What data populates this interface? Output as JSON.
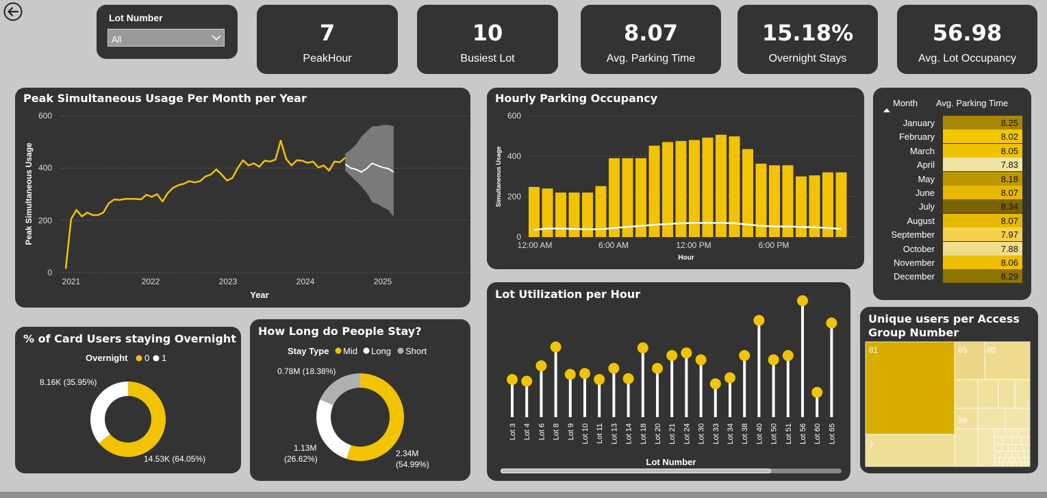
{
  "slicer": {
    "label": "Lot Number",
    "value": "All"
  },
  "kpis": [
    {
      "value": "7",
      "label": "PeakHour"
    },
    {
      "value": "10",
      "label": "Busiest Lot"
    },
    {
      "value": "8.07",
      "label": "Avg. Parking Time"
    },
    {
      "value": "15.18%",
      "label": "Overnight Stays"
    },
    {
      "value": "56.98",
      "label": "Avg. Lot Occupancy"
    }
  ],
  "colors": {
    "accent": "#f2c300",
    "card": "#333333",
    "background": "#c9c9c9"
  },
  "peak_chart": {
    "title": "Peak Simultaneous Usage Per Month per Year",
    "xlabel": "Year",
    "ylabel": "Peak Simultaneous Usage",
    "yticks": [
      "0",
      "200",
      "400",
      "600"
    ],
    "xticks": [
      "2021",
      "2022",
      "2023",
      "2024",
      "2025"
    ]
  },
  "hourly_chart": {
    "title": "Hourly Parking Occupancy",
    "xlabel": "Hour",
    "ylabel": "Simultaneous Usage",
    "yticks": [
      "0",
      "200",
      "400",
      "600"
    ],
    "xticks": [
      "12:00 AM",
      "6:00 AM",
      "12:00 PM",
      "6:00 PM"
    ]
  },
  "month_table": {
    "headers": [
      "Month",
      "Avg. Parking Time"
    ],
    "rows": [
      {
        "month": "January",
        "value": "8.25",
        "color": "#a88800"
      },
      {
        "month": "February",
        "value": "8.02",
        "color": "#f2c600"
      },
      {
        "month": "March",
        "value": "8.05",
        "color": "#f0c300"
      },
      {
        "month": "April",
        "value": "7.83",
        "color": "#f0e4a4"
      },
      {
        "month": "May",
        "value": "8.18",
        "color": "#bb9800"
      },
      {
        "month": "June",
        "value": "8.07",
        "color": "#e6b900"
      },
      {
        "month": "July",
        "value": "8.34",
        "color": "#7a6300"
      },
      {
        "month": "August",
        "value": "8.07",
        "color": "#e6b900"
      },
      {
        "month": "September",
        "value": "7.97",
        "color": "#f6d24c"
      },
      {
        "month": "October",
        "value": "7.88",
        "color": "#f2dd8a"
      },
      {
        "month": "November",
        "value": "8.06",
        "color": "#eebf00"
      },
      {
        "month": "December",
        "value": "8.29",
        "color": "#8e7300"
      }
    ]
  },
  "overnight": {
    "title": "% of Card Users staying Overnight",
    "legend_title": "Overnight",
    "legend": [
      "0",
      "1"
    ],
    "labels": {
      "one": "8.16K (35.95%)",
      "zero": "14.53K (64.05%)"
    }
  },
  "stay": {
    "title": "How Long do People Stay?",
    "legend_title": "Stay Type",
    "legend": [
      "Mid",
      "Long",
      "Short"
    ],
    "labels": {
      "short": "0.78M (18.38%)",
      "long_a": "1.13M",
      "long_b": "(26.62%)",
      "mid_a": "2.34M",
      "mid_b": "(54.99%)"
    }
  },
  "lot_util": {
    "title": "Lot Utilization per Hour",
    "xlabel": "Lot Number"
  },
  "treemap": {
    "title_a": "Unique users per Access",
    "title_b": "Group Number",
    "labels": [
      "81",
      "85",
      "80",
      "39",
      "7"
    ]
  },
  "chart_data": [
    {
      "type": "line",
      "title": "Peak Simultaneous Usage Per Month per Year",
      "xlabel": "Year",
      "ylabel": "Peak Simultaneous Usage",
      "ylim": [
        0,
        600
      ],
      "x_start": "2021-01",
      "grid": true,
      "series": [
        {
          "name": "Actual",
          "values": [
            15,
            205,
            240,
            215,
            230,
            220,
            220,
            230,
            265,
            280,
            278,
            282,
            282,
            282,
            280,
            298,
            290,
            300,
            272,
            305,
            325,
            335,
            340,
            350,
            345,
            350,
            368,
            375,
            395,
            375,
            352,
            362,
            400,
            430,
            410,
            418,
            405,
            428,
            425,
            432,
            505,
            435,
            410,
            430,
            428,
            420,
            425,
            402,
            410,
            390,
            425,
            422,
            440
          ]
        },
        {
          "name": "Forecast",
          "values": [
            415,
            400,
            395,
            385,
            398,
            418,
            410,
            402,
            398,
            385
          ]
        },
        {
          "name": "Forecast upper",
          "values": [
            455,
            470,
            490,
            520,
            540,
            560,
            560,
            565,
            565,
            560
          ]
        },
        {
          "name": "Forecast lower",
          "values": [
            390,
            370,
            350,
            330,
            305,
            270,
            262,
            250,
            240,
            215
          ]
        }
      ]
    },
    {
      "type": "bar",
      "title": "Hourly Parking Occupancy",
      "xlabel": "Hour",
      "ylabel": "Simultaneous Usage",
      "ylim": [
        0,
        600
      ],
      "categories": [
        "12 AM",
        "1 AM",
        "2 AM",
        "3 AM",
        "4 AM",
        "5 AM",
        "6 AM",
        "7 AM",
        "8 AM",
        "9 AM",
        "10 AM",
        "11 AM",
        "12 PM",
        "1 PM",
        "2 PM",
        "3 PM",
        "4 PM",
        "5 PM",
        "6 PM",
        "7 PM",
        "8 PM",
        "9 PM",
        "10 PM",
        "11 PM"
      ],
      "series": [
        {
          "name": "Peak",
          "values": [
            248,
            240,
            220,
            220,
            220,
            252,
            390,
            390,
            390,
            452,
            470,
            475,
            480,
            492,
            506,
            498,
            435,
            363,
            355,
            355,
            300,
            305,
            320,
            320
          ]
        },
        {
          "name": "Average",
          "values": [
            35,
            42,
            42,
            40,
            38,
            38,
            45,
            50,
            55,
            60,
            65,
            68,
            70,
            70,
            70,
            68,
            62,
            55,
            52,
            52,
            50,
            48,
            45,
            40
          ]
        }
      ]
    },
    {
      "type": "bar",
      "title": "Lot Utilization per Hour",
      "xlabel": "Lot Number",
      "categories": [
        "Lot 3",
        "Lot 4",
        "Lot 6",
        "Lot 8",
        "Lot 9",
        "Lot 10",
        "Lot 11",
        "Lot 13",
        "Lot 14",
        "Lot 18",
        "Lot 20",
        "Lot 21",
        "Lot 24",
        "Lot 30",
        "Lot 33",
        "Lot 34",
        "Lot 38",
        "Lot 40",
        "Lot 50",
        "Lot 51",
        "Lot 56",
        "Lot 60",
        "Lot 65"
      ],
      "values": [
        44,
        42,
        60,
        82,
        50,
        51,
        44,
        57,
        45,
        81,
        57,
        72,
        75,
        67,
        39,
        46,
        72,
        113,
        67,
        72,
        136,
        29,
        110
      ]
    },
    {
      "type": "pie",
      "title": "% of Card Users staying Overnight",
      "categories": [
        "0",
        "1"
      ],
      "values": [
        14530,
        8160
      ]
    },
    {
      "type": "pie",
      "title": "How Long do People Stay?",
      "categories": [
        "Mid",
        "Long",
        "Short"
      ],
      "values": [
        2.34,
        1.13,
        0.78
      ]
    }
  ]
}
